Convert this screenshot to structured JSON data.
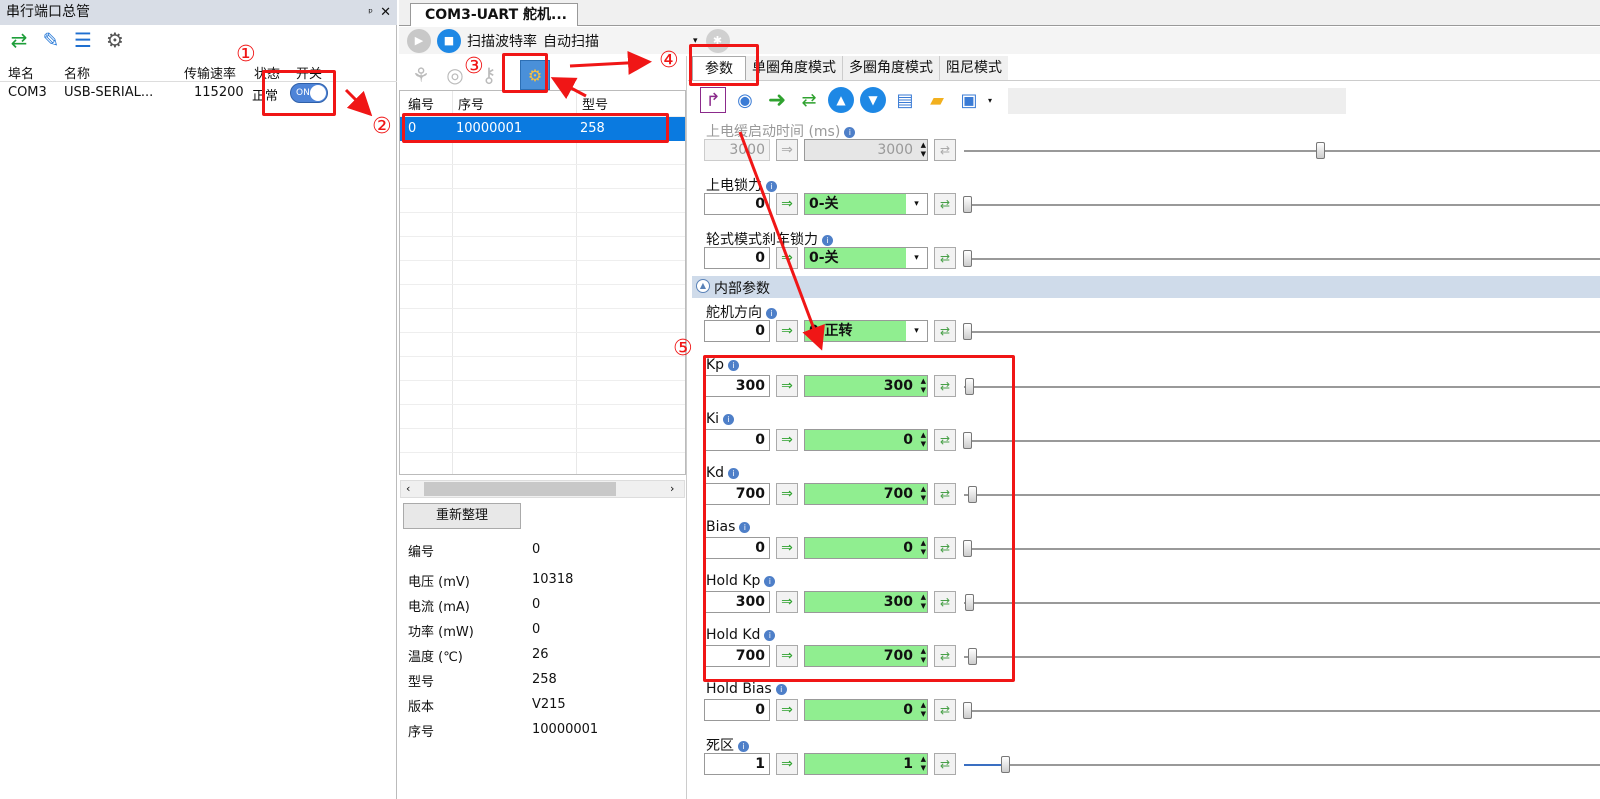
{
  "left_panel": {
    "title": "串行端口总管",
    "pin": "ᵖ",
    "close": "✕",
    "columns": [
      "埠名",
      "名称",
      "传输速率",
      "状态",
      "开关"
    ],
    "row": {
      "port": "COM3",
      "name": "USB-SERIAL...",
      "baud": "115200",
      "status": "正常",
      "toggle": "ON"
    }
  },
  "tab": {
    "title": "COM3-UART 舵机..."
  },
  "toolbar": {
    "scan_baud": "扫描波特率",
    "auto_scan": "自动扫描"
  },
  "device_grid": {
    "columns": [
      "编号",
      "序号",
      "型号"
    ],
    "row": {
      "id": "0",
      "serial": "10000001",
      "model": "258"
    }
  },
  "reorg_button": "重新整理",
  "info": [
    {
      "label": "编号",
      "value": "0"
    },
    {
      "label": "电压 (mV)",
      "value": "10318"
    },
    {
      "label": "电流 (mA)",
      "value": "0"
    },
    {
      "label": "功率 (mW)",
      "value": "0"
    },
    {
      "label": "温度 (℃)",
      "value": "26"
    },
    {
      "label": "型号",
      "value": "258"
    },
    {
      "label": "版本",
      "value": "V215"
    },
    {
      "label": "序号",
      "value": "10000001"
    }
  ],
  "param_tabs": [
    "参数",
    "单圈角度模式",
    "多圈角度模式",
    "阻尼模式"
  ],
  "section_internal": "内部参数",
  "params": {
    "startup": {
      "label": "上电缓启动时间 (ms)",
      "value": "3000",
      "set": "3000"
    },
    "lock": {
      "label": "上电锁力",
      "value": "0",
      "option": "0-关"
    },
    "brake": {
      "label": "轮式模式刹车锁力",
      "value": "0",
      "option": "0-关"
    },
    "direction": {
      "label": "舵机方向",
      "value": "0",
      "option": "0-正转"
    },
    "kp": {
      "label": "Kp",
      "value": "300",
      "set": "300"
    },
    "ki": {
      "label": "Ki",
      "value": "0",
      "set": "0"
    },
    "kd": {
      "label": "Kd",
      "value": "700",
      "set": "700"
    },
    "bias": {
      "label": "Bias",
      "value": "0",
      "set": "0"
    },
    "hold_kp": {
      "label": "Hold Kp",
      "value": "300",
      "set": "300"
    },
    "hold_kd": {
      "label": "Hold Kd",
      "value": "700",
      "set": "700"
    },
    "hold_bias": {
      "label": "Hold Bias",
      "value": "0",
      "set": "0"
    },
    "deadzone": {
      "label": "死区",
      "value": "1",
      "set": "1"
    }
  },
  "annotations": [
    "①",
    "②",
    "③",
    "④",
    "⑤"
  ]
}
